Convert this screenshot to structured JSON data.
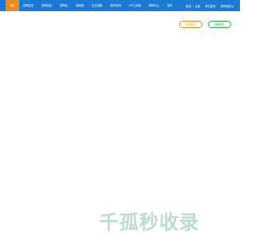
{
  "nav": {
    "items": [
      {
        "label": "首页",
        "active": true
      },
      {
        "label": "质量信息"
      },
      {
        "label": "招聘信息"
      },
      {
        "label": "招聘会"
      },
      {
        "label": "鑫软国"
      },
      {
        "label": "在业指数"
      },
      {
        "label": "教育培训"
      },
      {
        "label": "HR工具箱"
      },
      {
        "label": "帮助中心"
      },
      {
        "label": "更多"
      }
    ],
    "right": {
      "login": "登录",
      "separator": "|",
      "register": "注册",
      "link1": "单位登录",
      "link2": "领导登录派"
    }
  },
  "actions": {
    "post_job": "发布职位",
    "find_job": "搜索职位"
  },
  "watermark": {
    "text": "千孤秒收录"
  },
  "colors": {
    "nav_bg": "#1a7ad4",
    "accent_orange": "#f08a1c",
    "accent_green": "#2eab4c"
  }
}
